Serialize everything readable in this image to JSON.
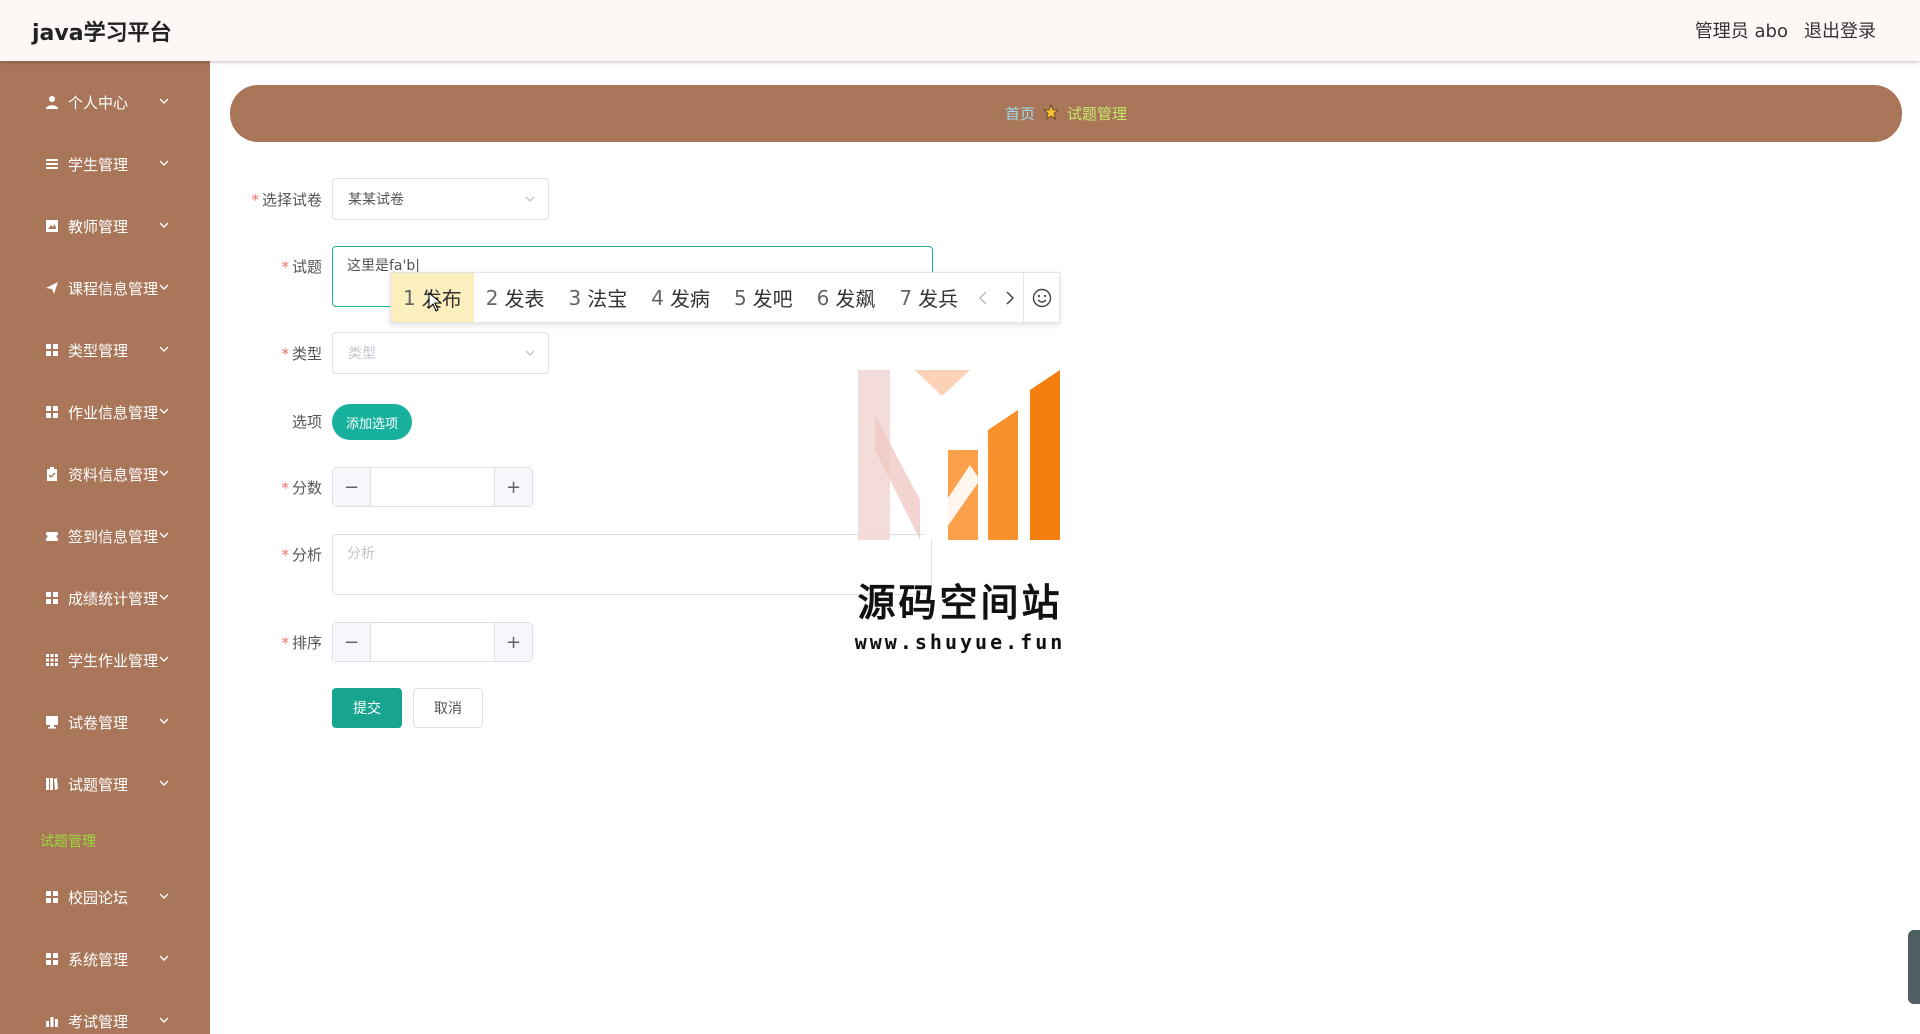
{
  "header": {
    "brand": "java学习平台",
    "user": "管理员 abo",
    "logout": "退出登录"
  },
  "sidebar": {
    "items": [
      {
        "label": "个人中心",
        "icon": "user-icon"
      },
      {
        "label": "学生管理",
        "icon": "list-icon"
      },
      {
        "label": "教师管理",
        "icon": "image-icon"
      },
      {
        "label": "课程信息管理",
        "icon": "send-icon"
      },
      {
        "label": "类型管理",
        "icon": "grid-icon"
      },
      {
        "label": "作业信息管理",
        "icon": "grid-icon"
      },
      {
        "label": "资料信息管理",
        "icon": "clipboard-icon"
      },
      {
        "label": "签到信息管理",
        "icon": "ticket-icon"
      },
      {
        "label": "成绩统计管理",
        "icon": "grid-icon"
      },
      {
        "label": "学生作业管理",
        "icon": "apps-icon"
      },
      {
        "label": "试卷管理",
        "icon": "monitor-icon"
      },
      {
        "label": "试题管理",
        "icon": "book-icon"
      },
      {
        "label": "校园论坛",
        "icon": "grid-icon"
      },
      {
        "label": "系统管理",
        "icon": "grid-icon"
      },
      {
        "label": "考试管理",
        "icon": "bar-chart-icon"
      }
    ],
    "active_sub": "试题管理"
  },
  "breadcrumb": {
    "home": "首页",
    "current": "试题管理"
  },
  "form": {
    "paper_label": "选择试卷",
    "paper_value": "某某试卷",
    "question_label": "试题",
    "question_value": "这里是fa'b|",
    "type_label": "类型",
    "type_placeholder": "类型",
    "options_label": "选项",
    "add_option": "添加选项",
    "score_label": "分数",
    "analysis_label": "分析",
    "analysis_placeholder": "分析",
    "order_label": "排序",
    "submit": "提交",
    "cancel": "取消"
  },
  "ime": {
    "candidates": [
      {
        "n": "1",
        "text": "发布",
        "selected": true
      },
      {
        "n": "2",
        "text": "发表"
      },
      {
        "n": "3",
        "text": "法宝"
      },
      {
        "n": "4",
        "text": "发病"
      },
      {
        "n": "5",
        "text": "发吧"
      },
      {
        "n": "6",
        "text": "发飙"
      },
      {
        "n": "7",
        "text": "发兵"
      }
    ]
  },
  "watermark": {
    "title": "源码空间站",
    "url": "www.shuyue.fun"
  },
  "colors": {
    "sidebar": "#a9765a",
    "accent": "#17b19d",
    "active_sub": "#9bd93c"
  }
}
